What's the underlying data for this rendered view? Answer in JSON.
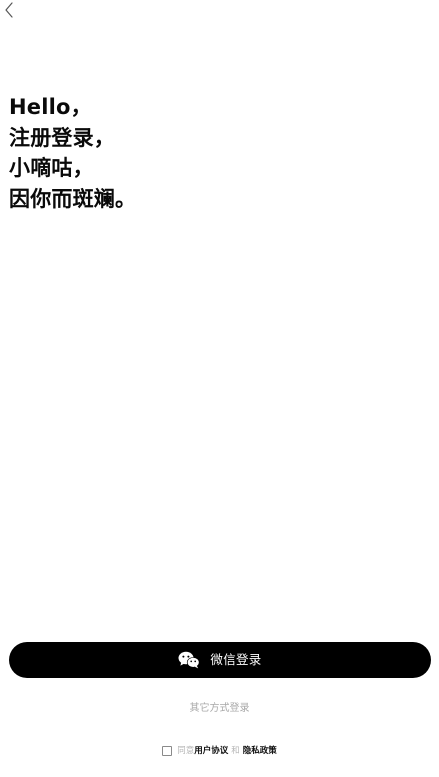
{
  "header": {
    "back_icon": "chevron-left-icon"
  },
  "headline": {
    "lines": [
      "Hello，",
      "注册登录，",
      "小嘀咕，",
      "因你而斑斓。"
    ]
  },
  "wechat_login": {
    "label": "微信登录",
    "icon": "wechat-icon",
    "background": "#000000",
    "text_color": "#ffffff"
  },
  "other_login": {
    "label": "其它方式登录"
  },
  "agreement": {
    "agree_text": "同意",
    "user_agreement": "用户协议",
    "and_text": "和",
    "privacy_policy": "隐私政策",
    "checked": false
  }
}
